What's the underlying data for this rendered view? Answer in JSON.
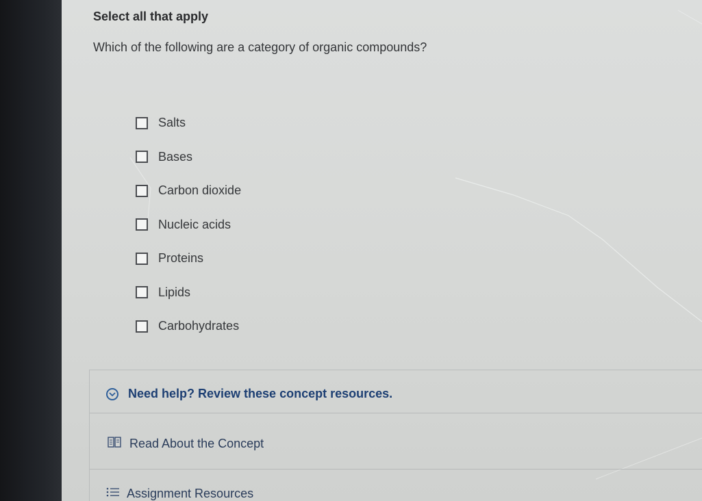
{
  "instruction": "Select all that apply",
  "question": "Which of the following are a category of organic compounds?",
  "options": [
    {
      "label": "Salts",
      "checked": false
    },
    {
      "label": "Bases",
      "checked": false
    },
    {
      "label": "Carbon dioxide",
      "checked": false
    },
    {
      "label": "Nucleic acids",
      "checked": false
    },
    {
      "label": "Proteins",
      "checked": false
    },
    {
      "label": "Lipids",
      "checked": false
    },
    {
      "label": "Carbohydrates",
      "checked": false
    }
  ],
  "help": {
    "title": "Need help? Review these concept resources.",
    "read_label": "Read About the Concept",
    "resources_label": "Assignment Resources"
  },
  "icons": {
    "expand": "chevron-down-circle-icon",
    "read": "book-icon",
    "resources": "list-icon"
  },
  "colors": {
    "link": "#1d3f73",
    "accent": "#2f5f9a"
  }
}
